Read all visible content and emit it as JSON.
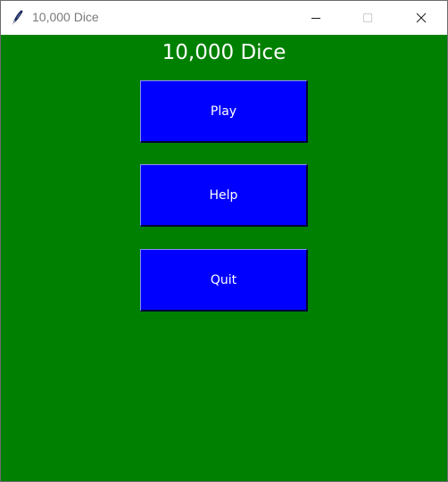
{
  "window": {
    "title": "10,000 Dice",
    "icon": "feather-icon",
    "controls": [
      "minimize-icon",
      "maximize-icon",
      "close-icon"
    ]
  },
  "main": {
    "heading": "10,000 Dice",
    "buttons": {
      "play": "Play",
      "help": "Help",
      "quit": "Quit"
    }
  },
  "colors": {
    "background": "#008000",
    "button": "#0000ff",
    "text": "#ffffff"
  }
}
